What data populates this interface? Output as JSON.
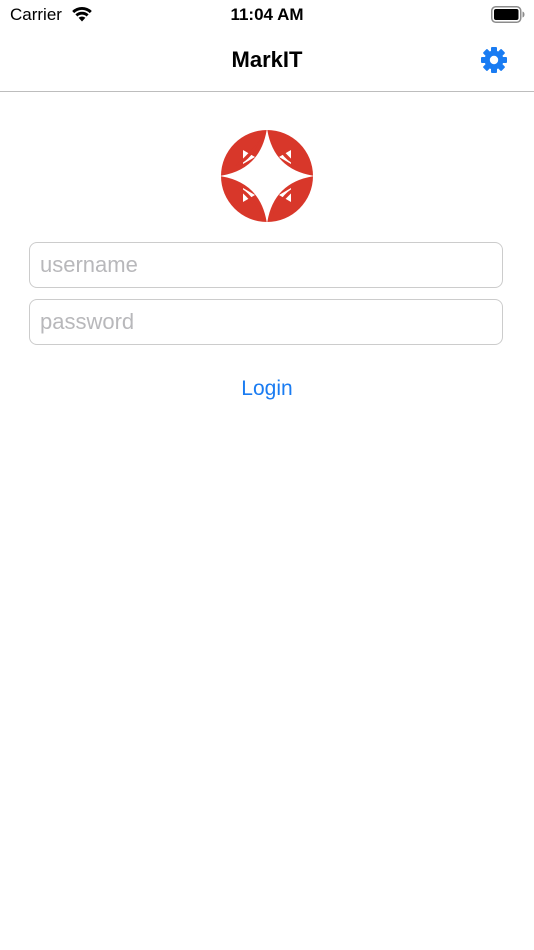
{
  "status_bar": {
    "carrier": "Carrier",
    "time": "11:04 AM",
    "wifi_icon": "wifi-icon",
    "battery_icon": "battery-icon"
  },
  "nav": {
    "title": "MarkIT",
    "settings_icon": "gear-icon"
  },
  "logo": {
    "icon": "markit-logo",
    "color": "#d8372a"
  },
  "login_form": {
    "username_placeholder": "username",
    "username_value": "",
    "password_placeholder": "password",
    "password_value": "",
    "login_label": "Login"
  },
  "colors": {
    "accent": "#1a7cf2",
    "brand_red": "#d8372a",
    "divider": "#bdbdbd",
    "placeholder": "#b8b8bb"
  }
}
